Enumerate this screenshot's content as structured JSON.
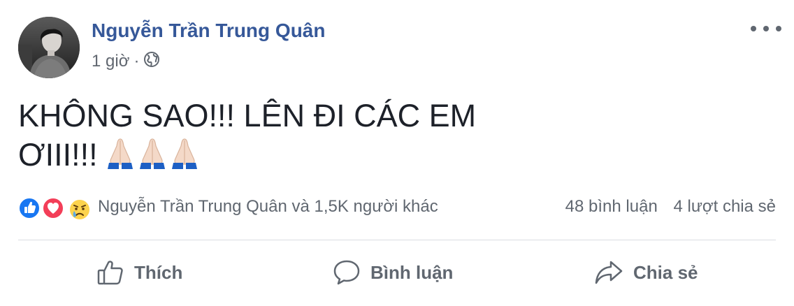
{
  "post": {
    "author_name": "Nguyễn Trần Trung Quân",
    "time": "1 giờ",
    "separator": "·",
    "privacy_icon": "globe-icon",
    "more_icon": "more-options-icon",
    "text_line1": "KHÔNG SAO!!! LÊN ĐI CÁC EM",
    "text_line2": "ƠIII!!!",
    "emojis": [
      "folded-hands-light-skin",
      "folded-hands-light-skin",
      "folded-hands-light-skin"
    ]
  },
  "reactions": {
    "icons": [
      "like-icon",
      "love-icon",
      "sad-icon"
    ],
    "names_text": "Nguyễn Trần Trung Quân và 1,5K người khác",
    "comments_count": "48 bình luận",
    "shares_count": "4 lượt chia sẻ"
  },
  "actions": {
    "like_label": "Thích",
    "comment_label": "Bình luận",
    "share_label": "Chia sẻ"
  },
  "colors": {
    "author": "#365899",
    "secondary_text": "#606770",
    "like_blue": "#1877f2",
    "love_red": "#f33e58",
    "sad_yellow": "#fcd34d"
  }
}
